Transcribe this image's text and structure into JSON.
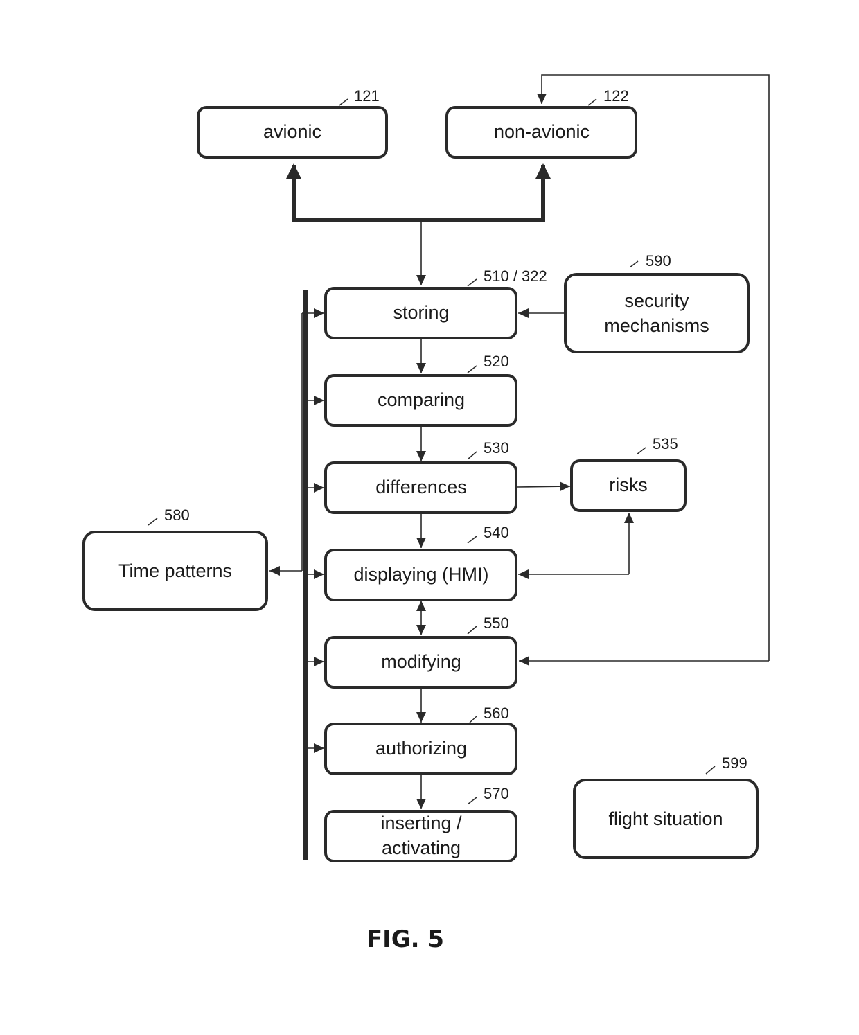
{
  "figure": {
    "caption": "FIG. 5"
  },
  "nodes": {
    "avionic": {
      "label": "avionic",
      "ref": "121"
    },
    "non_avionic": {
      "label": "non-avionic",
      "ref": "122"
    },
    "storing": {
      "label": "storing",
      "ref": "510 / 322"
    },
    "security": {
      "label_line1": "security",
      "label_line2": "mechanisms",
      "ref": "590"
    },
    "comparing": {
      "label": "comparing",
      "ref": "520"
    },
    "differences": {
      "label": "differences",
      "ref": "530"
    },
    "risks": {
      "label": "risks",
      "ref": "535"
    },
    "displaying": {
      "label": "displaying (HMI)",
      "ref": "540"
    },
    "modifying": {
      "label": "modifying",
      "ref": "550"
    },
    "authorizing": {
      "label": "authorizing",
      "ref": "560"
    },
    "inserting": {
      "label_line1": "inserting /",
      "label_line2": "activating",
      "ref": "570"
    },
    "time_patterns": {
      "label": "Time patterns",
      "ref": "580"
    },
    "flight_situation": {
      "label": "flight situation",
      "ref": "599"
    }
  },
  "edges": [
    {
      "from": "storing",
      "to": "avionic",
      "style": "thick"
    },
    {
      "from": "storing",
      "to": "non_avionic",
      "style": "thick"
    },
    {
      "from": "security",
      "to": "storing"
    },
    {
      "from": "storing",
      "to": "comparing"
    },
    {
      "from": "comparing",
      "to": "differences"
    },
    {
      "from": "differences",
      "to": "risks"
    },
    {
      "from": "differences",
      "to": "displaying"
    },
    {
      "from": "displaying",
      "to": "risks",
      "bidirectional": true
    },
    {
      "from": "displaying",
      "to": "modifying",
      "bidirectional": true
    },
    {
      "from": "modifying",
      "to": "authorizing"
    },
    {
      "from": "authorizing",
      "to": "inserting"
    },
    {
      "from": "modifying",
      "to": "non_avionic",
      "note": "feedback loop"
    },
    {
      "from": "bus",
      "to": "time_patterns"
    }
  ]
}
